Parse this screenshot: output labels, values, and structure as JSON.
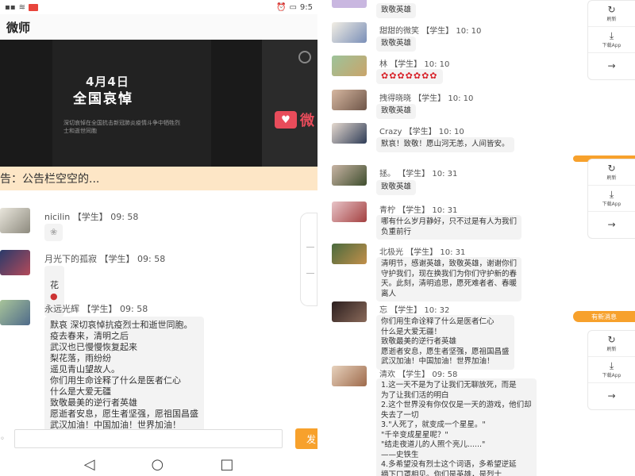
{
  "status_bar": {
    "time": "9:5"
  },
  "app": {
    "title": "微师"
  },
  "banner": {
    "date": "4月4日",
    "headline": "全国哀悼",
    "subtitle": "深切哀悼在全国抗击新冠肺炎疫情斗争中牺牲烈士和逝世同胞",
    "logo_glyph": "微"
  },
  "notice": {
    "text": "告：公告栏空空的..."
  },
  "left_messages": [
    {
      "name": "nicilin",
      "role": "【学生】",
      "time": "09: 58",
      "text": "❀"
    },
    {
      "name": "月光下的孤寂",
      "role": "【学生】",
      "time": "09: 58",
      "text": "花"
    },
    {
      "name": "永远光辉",
      "role": "【学生】",
      "time": "09: 58",
      "text": "默哀 深切哀悼抗疫烈士和逝世同胞。\n疫去春来，清明之后\n武汉也已慢慢恢复起来\n梨花落，雨纷纷\n遥见青山望故人。\n你们用生命诠释了什么是医者仁心\n什么是大爱无疆\n致敬最美的逆行者英雄\n愿逝者安息，愿生者坚强，愿祖国昌盛\n武汉加油！中国加油！世界加油！"
    }
  ],
  "input": {
    "send_label": "发"
  },
  "right_messages": [
    {
      "name": "",
      "role": "",
      "time": "",
      "text": "致敬英雄"
    },
    {
      "name": "甜甜的微笑",
      "role": "【学生】",
      "time": "10: 10",
      "text": "致敬英雄"
    },
    {
      "name": "林",
      "role": "【学生】",
      "time": "10: 10",
      "text": "✿✿✿✿✿✿✿"
    },
    {
      "name": "拽得晓晓",
      "role": "【学生】",
      "time": "10: 10",
      "text": "致敬英雄"
    },
    {
      "name": "Crazy",
      "role": "【学生】",
      "time": "10: 10",
      "text": "默哀！致敬！愿山河无恙，人间皆安。"
    },
    {
      "name": "拯。",
      "role": "【学生】",
      "time": "10: 31",
      "text": "致敬英雄"
    },
    {
      "name": "青柠",
      "role": "【学生】",
      "time": "10: 31",
      "text": "哪有什么岁月静好，只不过是有人为我们\n负重前行"
    },
    {
      "name": "北极光",
      "role": "【学生】",
      "time": "10: 31",
      "text": "清明节，感谢英雄，致敬英雄，谢谢你们\n守护我们，现在换我们为你们守护新的春\n天。此刻，清明追思，愿死难者者、春暖\n离人"
    },
    {
      "name": "忘",
      "role": "【学生】",
      "time": "10: 32",
      "text": "你们用生命诠释了什么是医者仁心\n什么是大爱无疆！\n致敬最美的逆行者英雄\n愿逝者安息，愿生者坚强，愿祖国昌盛\n武汉加油！中国加油！世界加油！"
    },
    {
      "name": "清欢",
      "role": "【学生】",
      "time": "09: 58",
      "text": "1.这一天不是为了让我们无聊放死，而是\n为了让我们活的明白\n2.这个世界没有你仅仅是一天的游戏，他们却\n失去了一切\n3.\"人死了，就变成一个星星。\"\n\"千辛变成星星呢？\"\n\"结走夜道儿的人照个亮儿......\"\n——史铁生\n4.多希望没有烈士这个词语，多希望逆延\n摘下口罩相见。你们是英雄，是烈士"
    }
  ],
  "toolbar": {
    "refresh_label": "刷新",
    "download_label": "下载App",
    "forward_label": "→"
  },
  "new_message_label": "有新消息",
  "colors": {
    "accent": "#f7a12c",
    "notice_bg": "#fde6c6",
    "bubble": "#f3f3f3",
    "logo": "#e84c5b"
  }
}
